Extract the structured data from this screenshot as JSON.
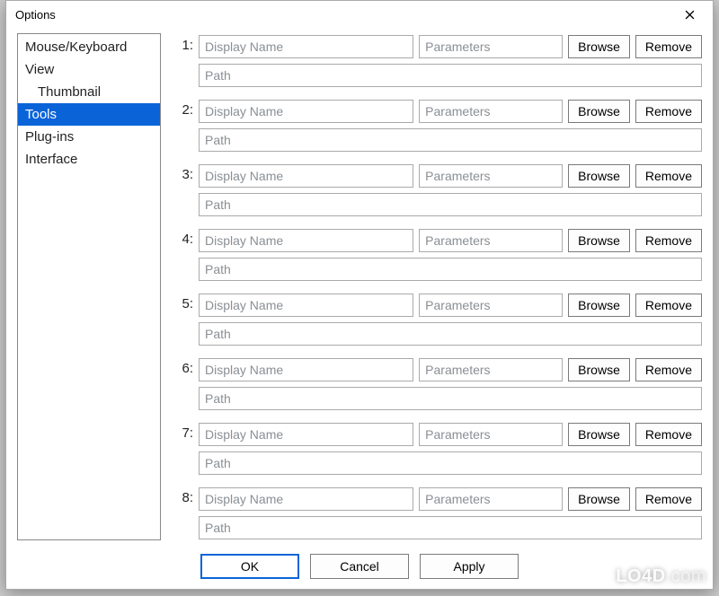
{
  "dialog": {
    "title": "Options",
    "close_aria": "Close"
  },
  "sidebar": {
    "items": [
      {
        "label": "Mouse/Keyboard",
        "indent": false,
        "selected": false
      },
      {
        "label": "View",
        "indent": false,
        "selected": false
      },
      {
        "label": "Thumbnail",
        "indent": true,
        "selected": false
      },
      {
        "label": "Tools",
        "indent": false,
        "selected": true
      },
      {
        "label": "Plug-ins",
        "indent": false,
        "selected": false
      },
      {
        "label": "Interface",
        "indent": false,
        "selected": false
      }
    ]
  },
  "tools": {
    "placeholders": {
      "name": "Display Name",
      "params": "Parameters",
      "path": "Path"
    },
    "browse_label": "Browse",
    "remove_label": "Remove",
    "rows": [
      {
        "index": "1:",
        "name": "",
        "params": "",
        "path": ""
      },
      {
        "index": "2:",
        "name": "",
        "params": "",
        "path": ""
      },
      {
        "index": "3:",
        "name": "",
        "params": "",
        "path": ""
      },
      {
        "index": "4:",
        "name": "",
        "params": "",
        "path": ""
      },
      {
        "index": "5:",
        "name": "",
        "params": "",
        "path": ""
      },
      {
        "index": "6:",
        "name": "",
        "params": "",
        "path": ""
      },
      {
        "index": "7:",
        "name": "",
        "params": "",
        "path": ""
      },
      {
        "index": "8:",
        "name": "",
        "params": "",
        "path": ""
      }
    ]
  },
  "footer": {
    "ok": "OK",
    "cancel": "Cancel",
    "apply": "Apply"
  },
  "watermark": {
    "brand": "LO4D",
    "tld": ".com"
  }
}
